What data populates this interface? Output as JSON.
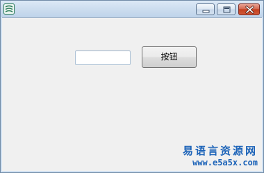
{
  "window": {
    "app_icon": "app-logo-icon",
    "controls": {
      "minimize_icon": "minimize-icon",
      "maximize_icon": "maximize-icon",
      "close_icon": "close-icon"
    }
  },
  "form": {
    "text_input_value": "",
    "button_label": "按钮"
  },
  "watermark": {
    "title": "易语言资源网",
    "url": "www.e5a5x.com"
  },
  "colors": {
    "titlebar": "#cbdcee",
    "client_background": "#f0f0f0",
    "close_button": "#c4401f",
    "watermark_text": "#1c63b8"
  }
}
